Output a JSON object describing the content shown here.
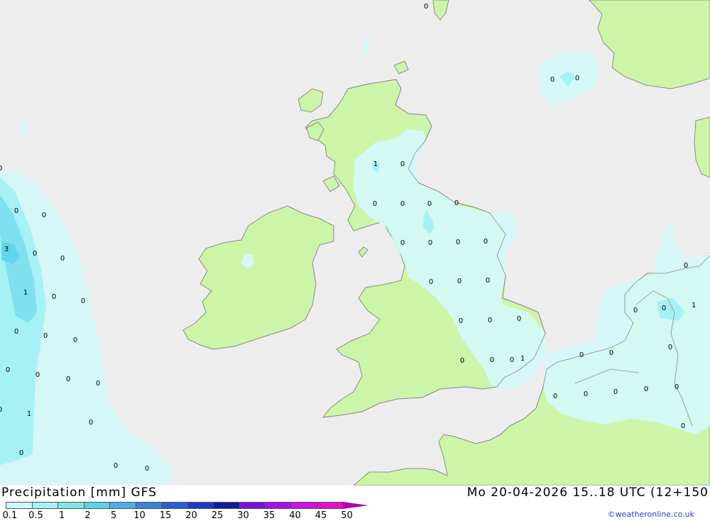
{
  "title": "Precipitation [mm] GFS",
  "valid_time": "Mo 20-04-2026 15..18 UTC (12+150",
  "credit": "©weatheronline.co.uk",
  "colors": {
    "sea": "#ededed",
    "land": "#ccf5a9",
    "coast": "#8a8a8a",
    "precip_light": "#d4f8f8",
    "precip_mid": "#a6f1f5",
    "precip_heavy": "#7fe0ee"
  },
  "legend": {
    "ticks": [
      "0.1",
      "0.5",
      "1",
      "2",
      "5",
      "10",
      "15",
      "20",
      "25",
      "30",
      "35",
      "40",
      "45",
      "50"
    ],
    "colors": [
      "#ccfafa",
      "#a6f2f2",
      "#80e6e6",
      "#5ad2ea",
      "#4aaee8",
      "#3a84e0",
      "#2a5ed6",
      "#1c3cc2",
      "#0c1ca0",
      "#7a10e0",
      "#a810e8",
      "#d010e8",
      "#e010d0",
      "#b000b0"
    ]
  },
  "point_values": [
    "0",
    "0",
    "0",
    "0",
    "0",
    "0",
    "3",
    "0",
    "0",
    "1",
    "0",
    "0",
    "0",
    "0",
    "0",
    "0",
    "0",
    "0",
    "0",
    "0",
    "1",
    "0",
    "0",
    "0",
    "0",
    "1",
    "0",
    "0",
    "0",
    "0",
    "0",
    "0",
    "0",
    "0",
    "0",
    "0",
    "0",
    "0",
    "0",
    "0",
    "0",
    "0",
    "0",
    "0",
    "1",
    "0",
    "0",
    "0",
    "0",
    "0",
    "0",
    "0",
    "0",
    "0",
    "1",
    "0",
    "0",
    "0",
    "0",
    "0",
    "0",
    "0",
    "0"
  ]
}
